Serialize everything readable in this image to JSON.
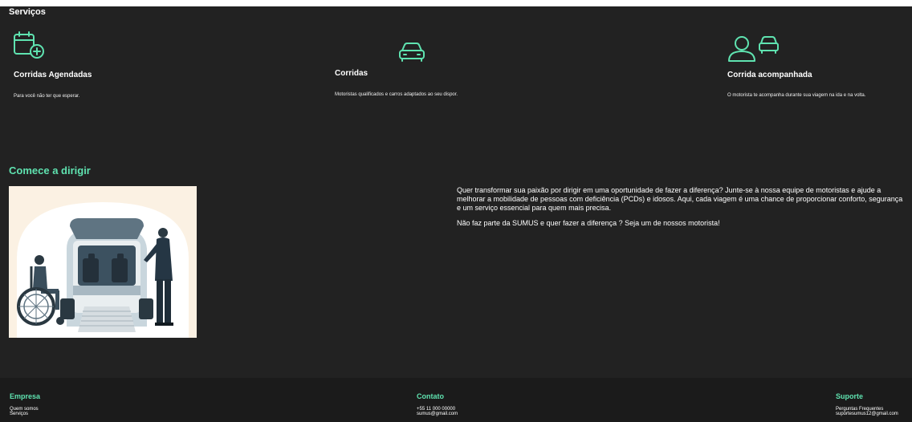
{
  "services_section": {
    "title": "Serviços",
    "items": [
      {
        "icon": "calendar-plus-icon",
        "title": "Corridas Agendadas",
        "desc": "Para você não ter que esperar."
      },
      {
        "icon": "car-icon",
        "title": "Corridas",
        "desc": "Motoristas qualificados e carros adaptados ao seu dispor."
      },
      {
        "icon": "person-car-icon",
        "title": "Corrida acompanhada",
        "desc": "O motorista te acompanha durante sua viagem na ida e na volta."
      }
    ]
  },
  "drive_section": {
    "title": "Comece a dirigir",
    "paragraph_1": "Quer transformar sua paixão por dirigir em uma oportunidade de fazer a diferença? Junte-se à nossa equipe de motoristas e ajude a melhorar a mobilidade de pessoas com deficiência (PCDs) e idosos. Aqui, cada viagem é uma chance de proporcionar conforto, segurança e um serviço essencial para quem mais precisa.",
    "paragraph_2": "Não faz parte da SUMUS e quer fazer a diferença ? Seja um de nossos motorista!"
  },
  "footer": {
    "empresa": {
      "title": "Empresa",
      "links": [
        "Quem somos",
        "Serviços"
      ]
    },
    "contato": {
      "title": "Contato",
      "lines": [
        "+55 11 000 00000",
        "sumus@gmail.com"
      ]
    },
    "suporte": {
      "title": "Suporte",
      "lines": [
        "Perguntas Frequentes",
        "suportesumus12@gmail.com"
      ]
    }
  },
  "colors": {
    "background": "#222222",
    "footer_background": "#1b1b1b",
    "accent": "#5fe3b0",
    "illustration_bg": "#fbf1e3"
  }
}
